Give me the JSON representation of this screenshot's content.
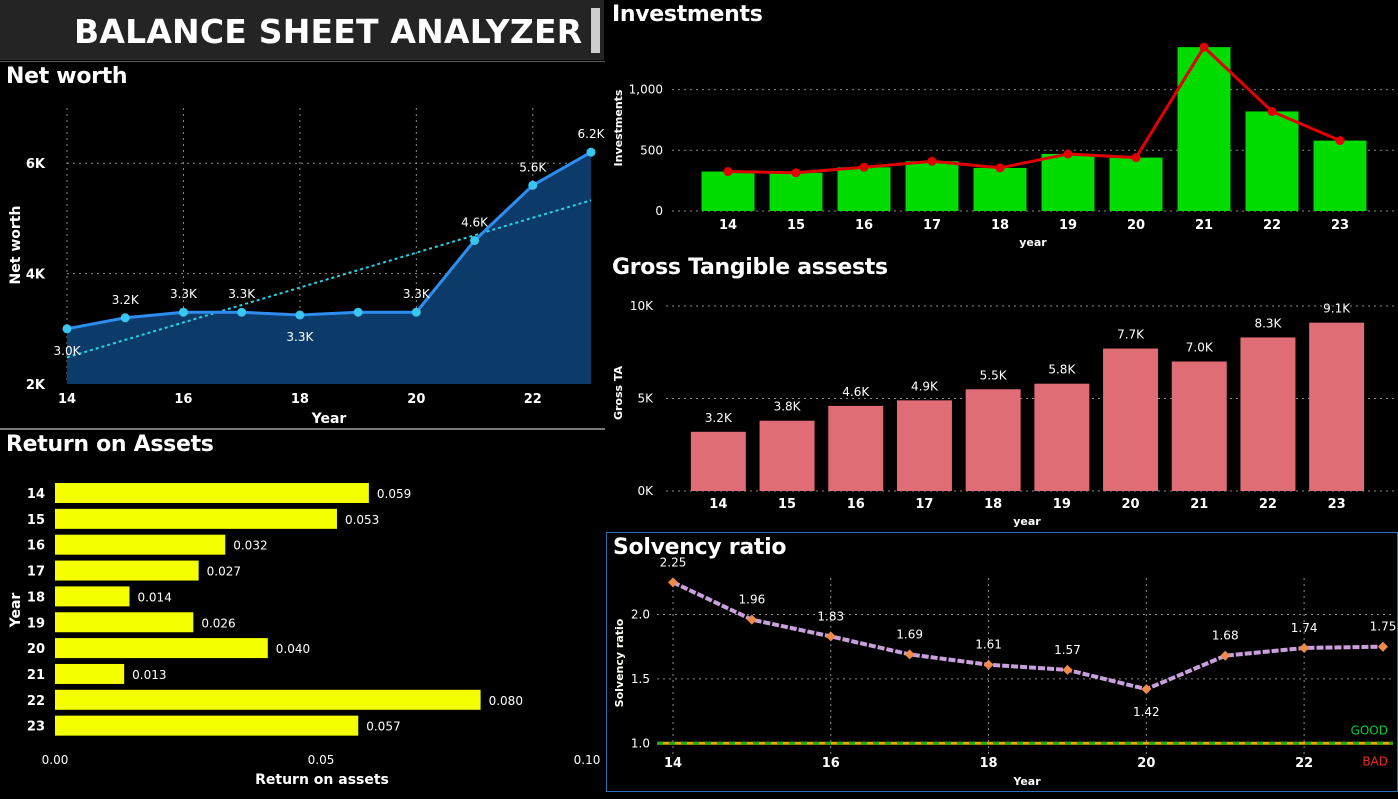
{
  "header": {
    "title": "BALANCE SHEET ANALYZER"
  },
  "panels": {
    "net_worth": "Net worth",
    "roa": "Return on Assets",
    "investments": "Investments",
    "gta": "Gross Tangible assests",
    "solvency": "Solvency ratio"
  },
  "colors": {
    "blue_line": "#2f8df0",
    "blue_fill": "#0c3b69",
    "trend": "#29d3e6",
    "yellow": "#f4ff00",
    "green": "#00dc00",
    "red_line": "#e20000",
    "pink": "#e06c75",
    "lavender": "#c9a0dc",
    "orange_marker": "#f08a4b",
    "good": "#00cc44",
    "bad": "#ee2a1d"
  },
  "chart_data": [
    {
      "id": "net_worth",
      "type": "area",
      "title": "Net worth",
      "xlabel": "Year",
      "ylabel": "Net worth",
      "x": [
        14,
        15,
        16,
        17,
        18,
        19,
        20,
        21,
        22,
        23
      ],
      "values": [
        3000,
        3200,
        3300,
        3300,
        3250,
        3300,
        3300,
        4600,
        5600,
        6200
      ],
      "data_labels": [
        "3.0K",
        "3.2K",
        "3.3K",
        "3.3K",
        "3.3K",
        "",
        "3.3K",
        "4.6K",
        "5.6K",
        "6.2K"
      ],
      "xticks": [
        "14",
        "16",
        "18",
        "20",
        "22"
      ],
      "yticks": [
        "2K",
        "4K",
        "6K"
      ],
      "ylim": [
        2000,
        7000
      ],
      "trendline": true,
      "grid": true
    },
    {
      "id": "roa",
      "type": "bar",
      "orientation": "horizontal",
      "title": "Return on Assets",
      "xlabel": "Return on assets",
      "ylabel": "Year",
      "categories": [
        "14",
        "15",
        "16",
        "17",
        "18",
        "19",
        "20",
        "21",
        "22",
        "23"
      ],
      "values": [
        0.059,
        0.053,
        0.032,
        0.027,
        0.014,
        0.026,
        0.04,
        0.013,
        0.08,
        0.057
      ],
      "data_labels": [
        "0.059",
        "0.053",
        "0.032",
        "0.027",
        "0.014",
        "0.026",
        "0.040",
        "0.013",
        "0.080",
        "0.057"
      ],
      "xticks": [
        "0.00",
        "0.05",
        "0.10"
      ],
      "xlim": [
        0,
        0.1
      ]
    },
    {
      "id": "investments",
      "type": "bar",
      "title": "Investments",
      "xlabel": "year",
      "ylabel": "Investments",
      "categories": [
        "14",
        "15",
        "16",
        "17",
        "18",
        "19",
        "20",
        "21",
        "22",
        "23"
      ],
      "series": [
        {
          "type": "bar",
          "values": [
            325,
            315,
            360,
            410,
            355,
            470,
            440,
            1350,
            820,
            580
          ]
        },
        {
          "type": "line",
          "values": [
            325,
            315,
            360,
            410,
            355,
            470,
            440,
            1350,
            820,
            580
          ]
        }
      ],
      "yticks": [
        "0",
        "500",
        "1,000"
      ],
      "ylim": [
        0,
        1450
      ],
      "grid": true
    },
    {
      "id": "gta",
      "type": "bar",
      "title": "Gross Tangible assests",
      "xlabel": "year",
      "ylabel": "Gross TA",
      "categories": [
        "14",
        "15",
        "16",
        "17",
        "18",
        "19",
        "20",
        "21",
        "22",
        "23"
      ],
      "values": [
        3200,
        3800,
        4600,
        4900,
        5500,
        5800,
        7700,
        7000,
        8300,
        9100
      ],
      "data_labels": [
        "3.2K",
        "3.8K",
        "4.6K",
        "4.9K",
        "5.5K",
        "5.8K",
        "7.7K",
        "7.0K",
        "8.3K",
        "9.1K"
      ],
      "yticks": [
        "0K",
        "5K",
        "10K"
      ],
      "ylim": [
        0,
        10000
      ],
      "grid": true
    },
    {
      "id": "solvency",
      "type": "line",
      "title": "Solvency ratio",
      "xlabel": "Year",
      "ylabel": "Solvency ratio",
      "x": [
        14,
        15,
        16,
        17,
        18,
        19,
        20,
        21,
        22,
        23
      ],
      "values": [
        2.25,
        1.96,
        1.83,
        1.69,
        1.61,
        1.57,
        1.42,
        1.68,
        1.74,
        1.75
      ],
      "data_labels": [
        "2.25",
        "1.96",
        "1.83",
        "1.69",
        "1.61",
        "1.57",
        "1.42",
        "1.68",
        "1.74",
        "1.75"
      ],
      "xticks": [
        "14",
        "16",
        "18",
        "20",
        "22"
      ],
      "yticks": [
        "1.0",
        "1.5",
        "2.0"
      ],
      "ylim": [
        0.8,
        2.4
      ],
      "reference_line": {
        "value": 1.0,
        "above_label": "GOOD",
        "below_label": "BAD"
      },
      "grid": true
    }
  ]
}
